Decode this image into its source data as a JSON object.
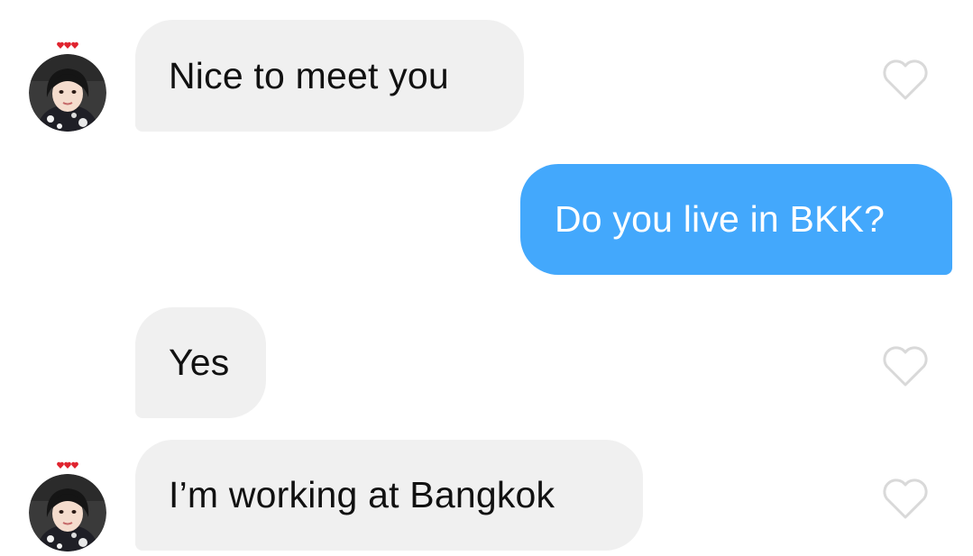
{
  "messages": [
    {
      "id": "m1",
      "direction": "incoming",
      "text": "Nice to meet you",
      "show_avatar": true,
      "liked": false
    },
    {
      "id": "m2",
      "direction": "outgoing",
      "text": "Do you live in BKK?"
    },
    {
      "id": "m3",
      "direction": "incoming",
      "text": "Yes",
      "show_avatar": false,
      "liked": false
    },
    {
      "id": "m4",
      "direction": "incoming",
      "text": "I’m working at Bangkok",
      "show_avatar": true,
      "liked": false
    }
  ],
  "icons": {
    "like": "heart-outline-icon",
    "avatar_badge": "three-hearts-icon"
  },
  "colors": {
    "incoming_bubble": "#f0f0f0",
    "incoming_text": "#111111",
    "outgoing_bubble": "#43a8fc",
    "outgoing_text": "#ffffff",
    "like_outline": "#d9d9d9",
    "badge_heart": "#e0242f"
  }
}
